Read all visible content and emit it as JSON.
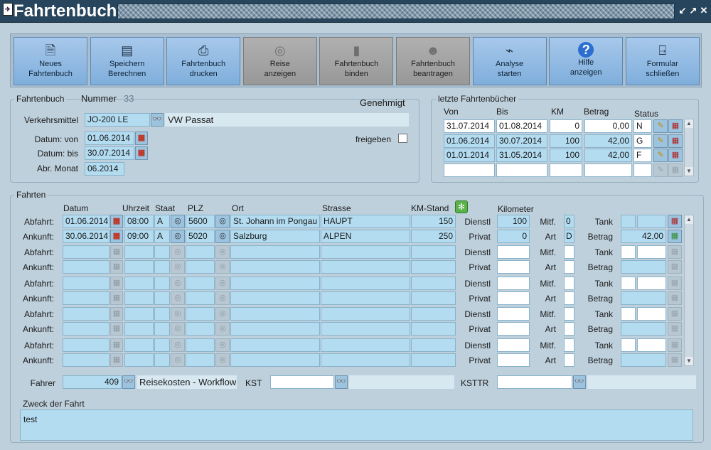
{
  "window": {
    "title": "Fahrtenbuch",
    "icon": "app-icon"
  },
  "toolbar": [
    {
      "id": "neues",
      "line1": "Neues",
      "line2": "Fahrtenbuch",
      "icon": "new-document-icon",
      "disabled": false
    },
    {
      "id": "speichern",
      "line1": "Speichern",
      "line2": "Berechnen",
      "icon": "calculator-icon",
      "disabled": false
    },
    {
      "id": "drucken",
      "line1": "Fahrtenbuch",
      "line2": "drucken",
      "icon": "printer-icon",
      "disabled": false
    },
    {
      "id": "reise",
      "line1": "Reise",
      "line2": "anzeigen",
      "icon": "binoculars-icon",
      "disabled": true
    },
    {
      "id": "binden",
      "line1": "Fahrtenbuch",
      "line2": "binden",
      "icon": "binder-icon",
      "disabled": true
    },
    {
      "id": "beantragen",
      "line1": "Fahrtenbuch",
      "line2": "beantragen",
      "icon": "user-request-icon",
      "disabled": true
    },
    {
      "id": "analyse",
      "line1": "Analyse",
      "line2": "starten",
      "icon": "chart-icon",
      "disabled": false
    },
    {
      "id": "hilfe",
      "line1": "Hilfe",
      "line2": "anzeigen",
      "icon": "help-icon",
      "disabled": false
    },
    {
      "id": "schliessen",
      "line1": "Formular",
      "line2": "schließen",
      "icon": "exit-door-icon",
      "disabled": false
    }
  ],
  "fahrtenbuch": {
    "legend": "Fahrtenbuch",
    "nummer_label": "Nummer",
    "nummer": "33",
    "status_text": "Genehmigt",
    "verkehrsmittel_label": "Verkehrsmittel",
    "verkehrsmittel": "JO-200 LE",
    "fahrzeug": "VW Passat",
    "datum_von_label": "Datum: von",
    "datum_von": "01.06.2014",
    "datum_bis_label": "Datum: bis",
    "datum_bis": "30.07.2014",
    "abr_monat_label": "Abr. Monat",
    "abr_monat": "06.2014",
    "freigeben_label": "freigeben"
  },
  "letzte": {
    "legend": "letzte Fahrtenbücher",
    "headers": {
      "von": "Von",
      "bis": "Bis",
      "km": "KM",
      "betrag": "Betrag",
      "status": "Status"
    },
    "rows": [
      {
        "von": "31.07.2014",
        "bis": "01.08.2014",
        "km": "0",
        "betrag": "0,00",
        "status": "N"
      },
      {
        "von": "01.06.2014",
        "bis": "30.07.2014",
        "km": "100",
        "betrag": "42,00",
        "status": "G"
      },
      {
        "von": "01.01.2014",
        "bis": "31.05.2014",
        "km": "100",
        "betrag": "42,00",
        "status": "F"
      },
      {
        "von": "",
        "bis": "",
        "km": "",
        "betrag": "",
        "status": ""
      }
    ]
  },
  "fahrten": {
    "legend": "Fahrten",
    "headers": {
      "datum": "Datum",
      "uhrzeit": "Uhrzeit",
      "staat": "Staat",
      "plz": "PLZ",
      "ort": "Ort",
      "strasse": "Strasse",
      "km_stand": "KM-Stand",
      "kilometer": "Kilometer"
    },
    "labels": {
      "abfahrt": "Abfahrt:",
      "ankunft": "Ankunft:",
      "dienstl": "Dienstl",
      "privat": "Privat",
      "mitf": "Mitf.",
      "art": "Art",
      "tank": "Tank",
      "betrag": "Betrag"
    },
    "trips": [
      {
        "abfahrt": {
          "datum": "01.06.2014",
          "uhrzeit": "08:00",
          "staat": "A",
          "plz": "5600",
          "ort": "St. Johann im Pongau",
          "strasse": "HAUPT",
          "km_stand": "150"
        },
        "ankunft": {
          "datum": "30.06.2014",
          "uhrzeit": "09:00",
          "staat": "A",
          "plz": "5020",
          "ort": "Salzburg",
          "strasse": "ALPEN",
          "km_stand": "250"
        },
        "dienstl": "100",
        "privat": "0",
        "mitf": "0",
        "art": "D",
        "tank": "",
        "betrag": "42,00"
      },
      {
        "abfahrt": {
          "datum": "",
          "uhrzeit": "",
          "staat": "",
          "plz": "",
          "ort": "",
          "strasse": "",
          "km_stand": ""
        },
        "ankunft": {
          "datum": "",
          "uhrzeit": "",
          "staat": "",
          "plz": "",
          "ort": "",
          "strasse": "",
          "km_stand": ""
        },
        "dienstl": "",
        "privat": "",
        "mitf": "",
        "art": "",
        "tank": "",
        "betrag": ""
      },
      {
        "abfahrt": {
          "datum": "",
          "uhrzeit": "",
          "staat": "",
          "plz": "",
          "ort": "",
          "strasse": "",
          "km_stand": ""
        },
        "ankunft": {
          "datum": "",
          "uhrzeit": "",
          "staat": "",
          "plz": "",
          "ort": "",
          "strasse": "",
          "km_stand": ""
        },
        "dienstl": "",
        "privat": "",
        "mitf": "",
        "art": "",
        "tank": "",
        "betrag": ""
      },
      {
        "abfahrt": {
          "datum": "",
          "uhrzeit": "",
          "staat": "",
          "plz": "",
          "ort": "",
          "strasse": "",
          "km_stand": ""
        },
        "ankunft": {
          "datum": "",
          "uhrzeit": "",
          "staat": "",
          "plz": "",
          "ort": "",
          "strasse": "",
          "km_stand": ""
        },
        "dienstl": "",
        "privat": "",
        "mitf": "",
        "art": "",
        "tank": "",
        "betrag": ""
      },
      {
        "abfahrt": {
          "datum": "",
          "uhrzeit": "",
          "staat": "",
          "plz": "",
          "ort": "",
          "strasse": "",
          "km_stand": ""
        },
        "ankunft": {
          "datum": "",
          "uhrzeit": "",
          "staat": "",
          "plz": "",
          "ort": "",
          "strasse": "",
          "km_stand": ""
        },
        "dienstl": "",
        "privat": "",
        "mitf": "",
        "art": "",
        "tank": "",
        "betrag": ""
      }
    ],
    "fahrer_label": "Fahrer",
    "fahrer_nr": "409",
    "fahrer_name": "Reisekosten - Workflow",
    "kst_label": "KST",
    "kst": "",
    "ksttr_label": "KSTTR",
    "ksttr": "",
    "zweck_label": "Zweck der Fahrt",
    "zweck": "test"
  }
}
